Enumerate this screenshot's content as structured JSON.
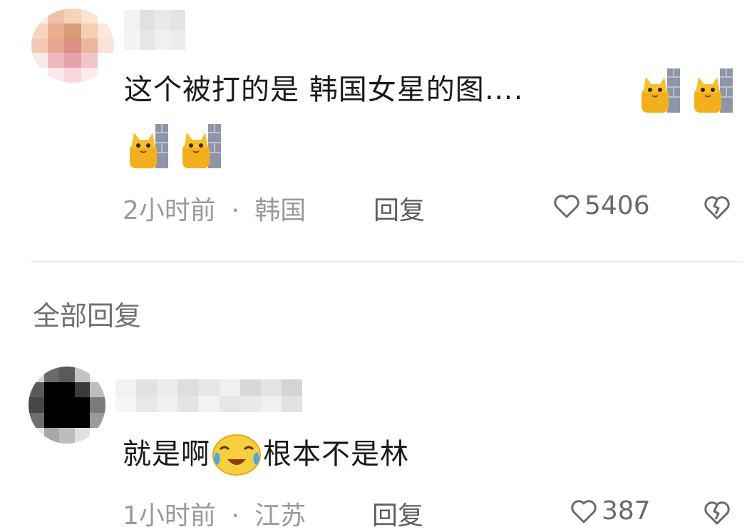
{
  "top_comment": {
    "text": "这个被打的是 韩国女星的图…. ",
    "emoji": "cat-emoji",
    "time": "2小时前",
    "location": "韩国",
    "separator": "·",
    "reply_label": "回复",
    "likes": "5406"
  },
  "section": {
    "title": "全部回复"
  },
  "reply_comment": {
    "text_before": "就是啊",
    "emoji": "crying-laughing-emoji",
    "text_after": "根本不是林",
    "time": "1小时前",
    "separator": "·",
    "location": "江苏",
    "reply_label": "回复",
    "likes": "387"
  },
  "colors": {
    "text": "#1a1a1a",
    "meta": "#9a9a9a",
    "divider": "#ececec"
  }
}
